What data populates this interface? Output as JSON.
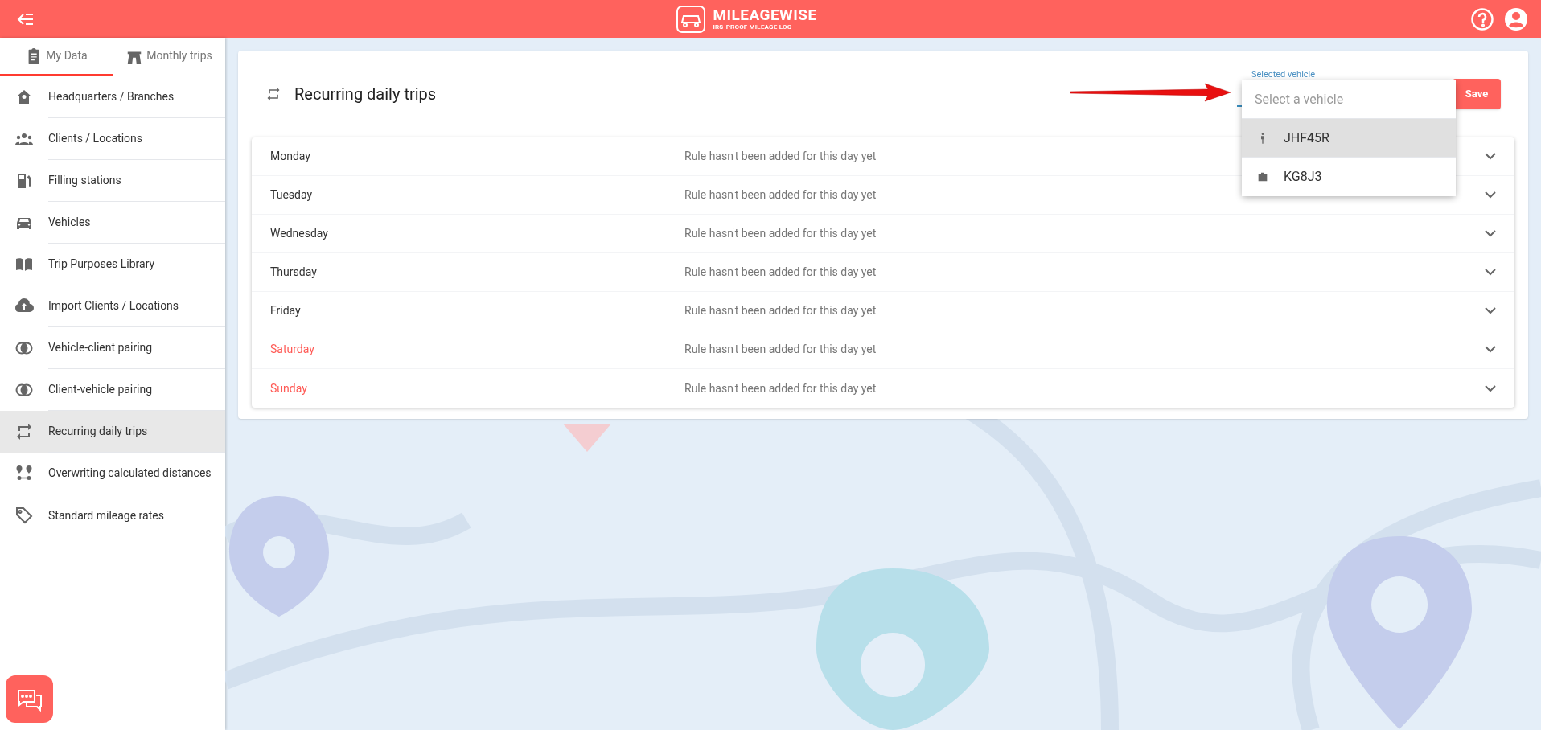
{
  "header": {
    "logo_title": "MILEAGEWISE",
    "logo_subtitle": "IRS-PROOF MILEAGE LOG"
  },
  "sidebar": {
    "tabs": [
      {
        "label": "My Data",
        "kind": "clipboard",
        "selected": true
      },
      {
        "label": "Monthly trips",
        "kind": "road",
        "selected": false
      }
    ],
    "items": [
      {
        "label": "Headquarters / Branches",
        "kind": "home",
        "selected": false
      },
      {
        "label": "Clients / Locations",
        "kind": "people",
        "selected": false
      },
      {
        "label": "Filling stations",
        "kind": "fuel",
        "selected": false
      },
      {
        "label": "Vehicles",
        "kind": "car",
        "selected": false
      },
      {
        "label": "Trip Purposes Library",
        "kind": "book",
        "selected": false
      },
      {
        "label": "Import Clients / Locations",
        "kind": "cloud",
        "selected": false
      },
      {
        "label": "Vehicle-client pairing",
        "kind": "rings",
        "selected": false
      },
      {
        "label": "Client-vehicle pairing",
        "kind": "rings",
        "selected": false
      },
      {
        "label": "Recurring daily trips",
        "kind": "repeat",
        "selected": true
      },
      {
        "label": "Overwriting calculated distances",
        "kind": "pins",
        "selected": false
      },
      {
        "label": "Standard mileage rates",
        "kind": "tag",
        "selected": false
      }
    ]
  },
  "page": {
    "title": "Recurring daily trips",
    "vehicle_field": {
      "label": "Selected vehicle",
      "placeholder": "Select a vehicle",
      "options": [
        {
          "label": "JHF45R",
          "kind": "person",
          "selected": true
        },
        {
          "label": "KG8J3",
          "kind": "briefcase",
          "selected": false
        }
      ]
    },
    "save_button": "Save",
    "days": [
      {
        "name": "Monday",
        "weekend": false,
        "status": "Rule hasn't been added for this day yet"
      },
      {
        "name": "Tuesday",
        "weekend": false,
        "status": "Rule hasn't been added for this day yet"
      },
      {
        "name": "Wednesday",
        "weekend": false,
        "status": "Rule hasn't been added for this day yet"
      },
      {
        "name": "Thursday",
        "weekend": false,
        "status": "Rule hasn't been added for this day yet"
      },
      {
        "name": "Friday",
        "weekend": false,
        "status": "Rule hasn't been added for this day yet"
      },
      {
        "name": "Saturday",
        "weekend": true,
        "status": "Rule hasn't been added for this day yet"
      },
      {
        "name": "Sunday",
        "weekend": true,
        "status": "Rule hasn't been added for this day yet"
      }
    ]
  }
}
